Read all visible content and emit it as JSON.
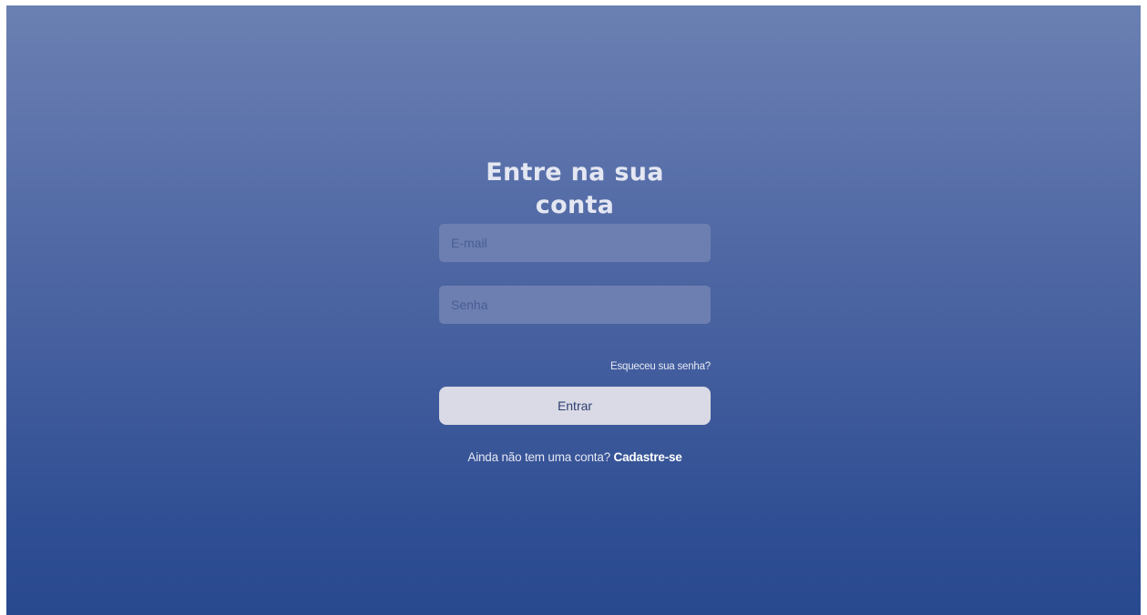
{
  "login": {
    "title": "Entre na sua conta",
    "email_placeholder": "E-mail",
    "password_placeholder": "Senha",
    "forgot_password": "Esqueceu sua senha?",
    "submit_label": "Entrar",
    "signup_prompt": "Ainda não tem uma conta?",
    "signup_link": "Cadastre-se"
  },
  "colors": {
    "gradient_top": "#6b80b2",
    "gradient_bottom": "#29498f",
    "input_background": "#6c7fb0",
    "button_background": "#d9dae5"
  }
}
